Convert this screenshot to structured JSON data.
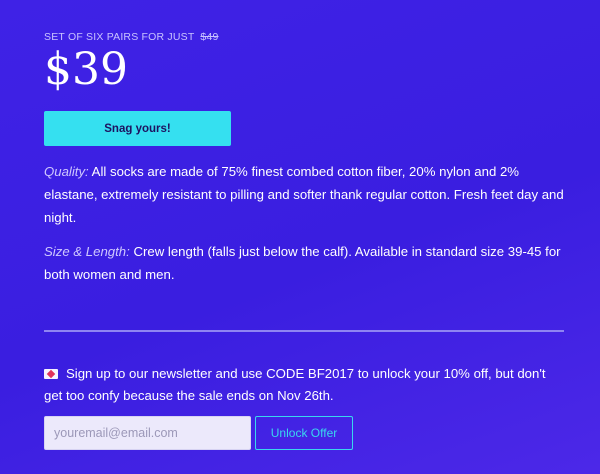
{
  "offer": {
    "label_prefix": "SET OF SIX PAIRS FOR JUST",
    "old_price": "$49",
    "price": "$39",
    "cta_label": "Snag yours!"
  },
  "details": [
    {
      "lead": "Quality:",
      "text": "All socks are made of 75% finest combed cotton fiber, 20% nylon and 2% elastane, extremely resistant to pilling and softer thank regular cotton. Fresh feet day and night."
    },
    {
      "lead": "Size & Length:",
      "text": "Crew length (falls just below the calf). Available in standard size 39-45 for both women and men."
    }
  ],
  "newsletter": {
    "icon": "love-letter-icon",
    "text": "Sign up to our newsletter and use CODE BF2017 to unlock your 10% off, but don't get too confy because the sale ends on Nov 26th.",
    "email_placeholder": "youremail@email.com",
    "button_label": "Unlock Offer"
  },
  "colors": {
    "background": "#3f22e6",
    "accent": "#35e0f0",
    "divider": "#8f84f2"
  }
}
